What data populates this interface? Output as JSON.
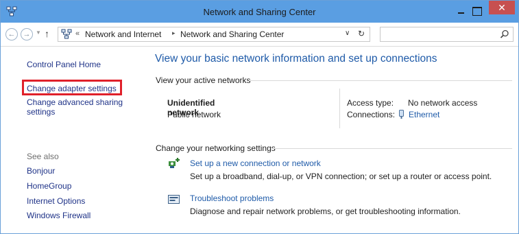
{
  "window": {
    "title": "Network and Sharing Center",
    "close_glyph": "✕"
  },
  "address_bar": {
    "back_glyph": "←",
    "forward_glyph": "→",
    "up_glyph": "↑",
    "separator": "«",
    "breadcrumbs": [
      "Network and Internet",
      "Network and Sharing Center"
    ],
    "breadcrumb_arrow": "▸",
    "refresh_glyph": "↻",
    "search_placeholder": ""
  },
  "sidebar": {
    "home_link": "Control Panel Home",
    "links": [
      "Change adapter settings",
      "Change advanced sharing settings"
    ],
    "see_also_label": "See also",
    "see_also": [
      "Bonjour",
      "HomeGroup",
      "Internet Options",
      "Windows Firewall"
    ],
    "highlighted_item": "Change adapter settings",
    "highlight_color": "#e0202a"
  },
  "main": {
    "heading": "View your basic network information and set up connections",
    "active_networks_label": "View your active networks",
    "network": {
      "name": "Unidentified network",
      "type": "Public network",
      "access_type_label": "Access type:",
      "access_type_value": "No network access",
      "connections_label": "Connections:",
      "connections_value": "Ethernet"
    },
    "settings_label": "Change your networking settings",
    "tasks": [
      {
        "icon": "new-connection-icon",
        "link": "Set up a new connection or network",
        "description": "Set up a broadband, dial-up, or VPN connection; or set up a router or access point."
      },
      {
        "icon": "troubleshoot-icon",
        "link": "Troubleshoot problems",
        "description": "Diagnose and repair network problems, or get troubleshooting information."
      }
    ]
  },
  "colors": {
    "titlebar": "#5a9ee2",
    "link": "#1e5aa8",
    "sidebar_link": "#1e3287",
    "close_button": "#c75050"
  }
}
